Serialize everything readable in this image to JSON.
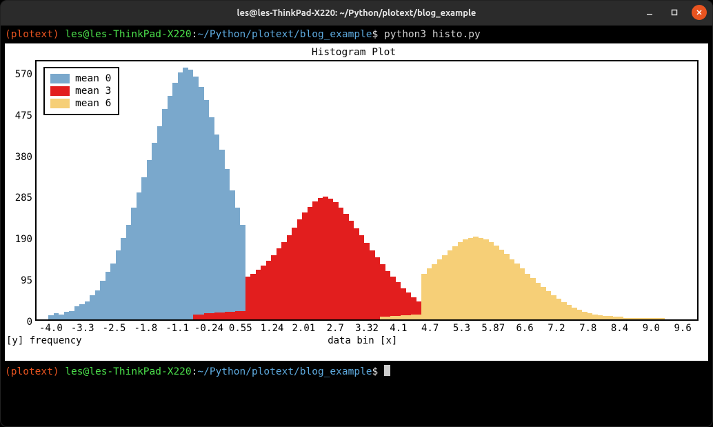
{
  "window": {
    "title": "les@les-ThinkPad-X220: ~/Python/plotext/blog_example"
  },
  "prompt": {
    "env": "(plotext)",
    "user": "les@les-ThinkPad-X220",
    "colon": ":",
    "path": "~/Python/plotext/blog_example",
    "symbol": "$",
    "command1": "python3 histo.py"
  },
  "axes": {
    "y_caption": "[y] frequency",
    "x_caption": "data bin [x]"
  },
  "colors": {
    "mean0": "#7aa8cc",
    "mean3": "#e21e1e",
    "mean6": "#f6cf77"
  },
  "chart_data": {
    "type": "bar",
    "title": "Histogram Plot",
    "xlabel": "data bin [x]",
    "ylabel": "frequency",
    "ylim": [
      0,
      600
    ],
    "y_ticks": [
      0,
      95,
      190,
      285,
      380,
      475,
      570
    ],
    "x_ticks": [
      "-4.0",
      "-3.3",
      "-2.5",
      "-1.8",
      "-1.1",
      "-0.24",
      "0.55",
      "1.24",
      "2.01",
      "2.7",
      "3.32",
      "4.1",
      "4.7",
      "5.3",
      "5.87",
      "6.6",
      "7.2",
      "7.8",
      "8.4",
      "9.0",
      "9.6"
    ],
    "legend": [
      "mean 0",
      "mean 3",
      "mean 6"
    ],
    "series": [
      {
        "name": "mean 0",
        "color": "#7aa8cc",
        "values": [
          0,
          0,
          10,
          14,
          12,
          18,
          20,
          30,
          36,
          42,
          56,
          68,
          90,
          110,
          130,
          160,
          190,
          220,
          260,
          295,
          330,
          370,
          410,
          450,
          490,
          520,
          550,
          575,
          585,
          580,
          565,
          540,
          510,
          470,
          430,
          395,
          350,
          300,
          260,
          220,
          96,
          96,
          96,
          96,
          92,
          88,
          80,
          72,
          64,
          56,
          48,
          40,
          30,
          22,
          18,
          12,
          6,
          0,
          0,
          0,
          0,
          0,
          0,
          0,
          0,
          0,
          0,
          0,
          0,
          0,
          0,
          0,
          0,
          0,
          0,
          0,
          0,
          0,
          0,
          0,
          0,
          0,
          0,
          0,
          0,
          0,
          0,
          0,
          0,
          0,
          0,
          0,
          0,
          0,
          0,
          0,
          0,
          0,
          0,
          0,
          0,
          0,
          0,
          0,
          0,
          0,
          0,
          0,
          0,
          0,
          0,
          0,
          0,
          0,
          0,
          0,
          0,
          0,
          0,
          0,
          0,
          0,
          0,
          0,
          0,
          0,
          0
        ]
      },
      {
        "name": "mean 3",
        "color": "#e21e1e",
        "values": [
          0,
          0,
          0,
          0,
          0,
          0,
          0,
          0,
          0,
          0,
          0,
          0,
          0,
          0,
          0,
          0,
          0,
          0,
          0,
          0,
          0,
          0,
          0,
          0,
          0,
          0,
          0,
          0,
          0,
          0,
          12,
          12,
          14,
          14,
          16,
          16,
          18,
          18,
          20,
          20,
          100,
          106,
          115,
          125,
          136,
          150,
          165,
          180,
          196,
          214,
          232,
          248,
          262,
          275,
          282,
          285,
          280,
          272,
          260,
          246,
          230,
          212,
          195,
          178,
          160,
          145,
          128,
          112,
          100,
          86,
          72,
          62,
          52,
          42,
          34,
          28,
          22,
          16,
          12,
          8,
          6,
          4,
          0,
          0,
          0,
          0,
          0,
          0,
          0,
          0,
          0,
          0,
          0,
          0,
          0,
          0,
          0,
          0,
          0,
          0,
          0,
          0,
          0,
          0,
          0,
          0,
          0,
          0,
          0,
          0,
          0,
          0,
          0,
          0,
          0,
          0,
          0,
          0,
          0,
          0,
          0,
          0,
          0,
          0,
          0,
          0,
          0
        ]
      },
      {
        "name": "mean 6",
        "color": "#f6cf77",
        "values": [
          0,
          0,
          0,
          0,
          0,
          0,
          0,
          0,
          0,
          0,
          0,
          0,
          0,
          0,
          0,
          0,
          0,
          0,
          0,
          0,
          0,
          0,
          0,
          0,
          0,
          0,
          0,
          0,
          0,
          0,
          0,
          0,
          0,
          0,
          0,
          0,
          0,
          0,
          0,
          0,
          0,
          0,
          0,
          0,
          0,
          0,
          0,
          0,
          0,
          0,
          0,
          0,
          0,
          0,
          0,
          0,
          0,
          0,
          0,
          0,
          0,
          0,
          0,
          0,
          0,
          0,
          6,
          6,
          8,
          8,
          10,
          10,
          12,
          12,
          106,
          118,
          128,
          140,
          150,
          160,
          170,
          180,
          186,
          190,
          192,
          190,
          186,
          180,
          172,
          162,
          152,
          140,
          130,
          118,
          106,
          96,
          85,
          75,
          65,
          56,
          48,
          40,
          34,
          28,
          22,
          18,
          14,
          12,
          10,
          8,
          8,
          6,
          6,
          4,
          4,
          4,
          4,
          4,
          4,
          4,
          4,
          0,
          0,
          0,
          0,
          0,
          0
        ]
      }
    ]
  }
}
